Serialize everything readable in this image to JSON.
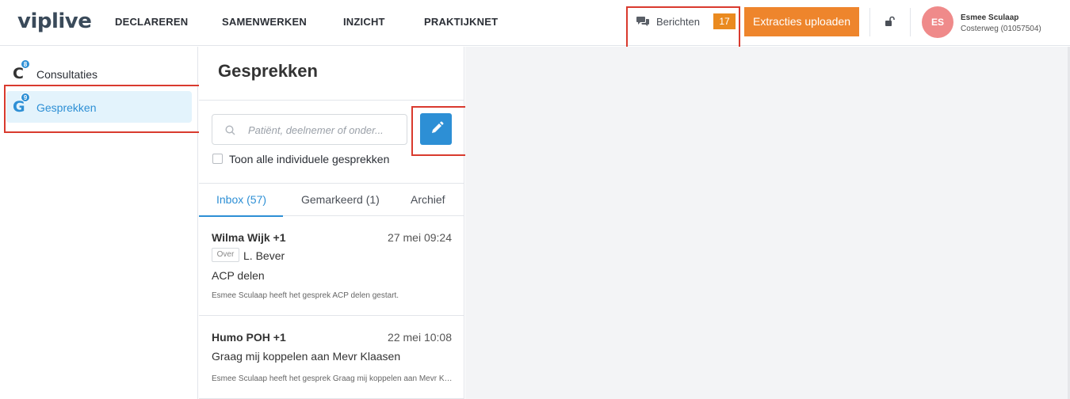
{
  "app": {
    "logo": "viplive"
  },
  "nav": [
    {
      "label": "DECLAREREN"
    },
    {
      "label": "SAMENWERKEN"
    },
    {
      "label": "INZICHT"
    },
    {
      "label": "PRAKTIJKNET"
    }
  ],
  "header": {
    "messages_label": "Berichten",
    "messages_count": "17",
    "upload_label": "Extracties uploaden",
    "user": {
      "initials": "ES",
      "name": "Esmee Sculaap",
      "location": "Costerweg (01057504)"
    },
    "colors": {
      "upload": "#ee852c",
      "badge": "#ea8a1f",
      "avatar": "#ef8a8a"
    }
  },
  "sidebar": {
    "items": [
      {
        "letter": "C",
        "badge": "8",
        "label": "Consultaties",
        "active": false
      },
      {
        "letter": "G",
        "badge": "9",
        "label": "Gesprekken",
        "active": true
      }
    ],
    "accent": "#2d8fd5"
  },
  "panel": {
    "title": "Gesprekken",
    "search_placeholder": "Patiënt, deelnemer of onder...",
    "show_all_label": "Toon alle individuele gesprekken",
    "tabs": [
      {
        "label": "Inbox (57)",
        "active": true
      },
      {
        "label": "Gemarkeerd (1)",
        "active": false
      },
      {
        "label": "Archief",
        "active": false
      }
    ],
    "conversations": [
      {
        "name": "Wilma Wijk +1",
        "date": "27 mei 09:24",
        "over_tag": "Over",
        "over_name": "L. Bever",
        "subject": "ACP delen",
        "snippet": "Esmee Sculaap heeft het gesprek ACP delen gestart."
      },
      {
        "name": "Humo POH +1",
        "date": "22 mei 10:08",
        "subject": "Graag mij koppelen aan Mevr Klaasen",
        "snippet": "Esmee Sculaap heeft het gesprek Graag mij koppelen aan Mevr Klaasen gestart."
      }
    ]
  }
}
